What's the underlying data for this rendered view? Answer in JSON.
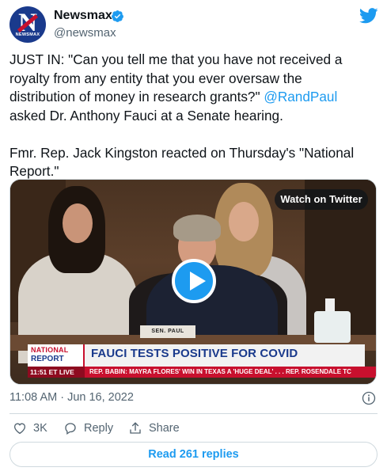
{
  "author": {
    "name": "Newsmax",
    "handle": "@newsmax",
    "verified": true,
    "avatar_text": "N",
    "avatar_word": "NEWSMAX"
  },
  "tweet": {
    "lines": [
      "JUST IN: \"Can you tell me that you have not received a",
      "royalty from any entity that you ever oversaw the",
      "distribution of money in research grants?\"",
      "asked Dr. Anthony Fauci at a Senate hearing.",
      "Fmr. Rep. Jack Kingston reacted on Thursday's \"National",
      "Report.\""
    ],
    "mention": "@RandPaul"
  },
  "media": {
    "watch_label": "Watch on Twitter",
    "nameplate": "SEN. PAUL",
    "show_logo_line1": "NATIONAL",
    "show_logo_line2": "REPORT",
    "headline": "FAUCI TESTS POSITIVE FOR COVID",
    "ticker_time": "11:51 ET  LIVE",
    "ticker_text": "REP. BABIN: MAYRA FLORES' WIN IN TEXAS A 'HUGE DEAL' . . .     REP. ROSENDALE TC"
  },
  "meta": {
    "timestamp": "11:08 AM · Jun 16, 2022"
  },
  "actions": {
    "likes": "3K",
    "reply_label": "Reply",
    "share_label": "Share"
  },
  "replies_button": "Read 261 replies",
  "colors": {
    "accent": "#1d9bf0",
    "text": "#0f1419",
    "muted": "#536471",
    "border": "#cfd9de",
    "brand_red": "#c8102e",
    "brand_blue": "#1a3a8c"
  }
}
